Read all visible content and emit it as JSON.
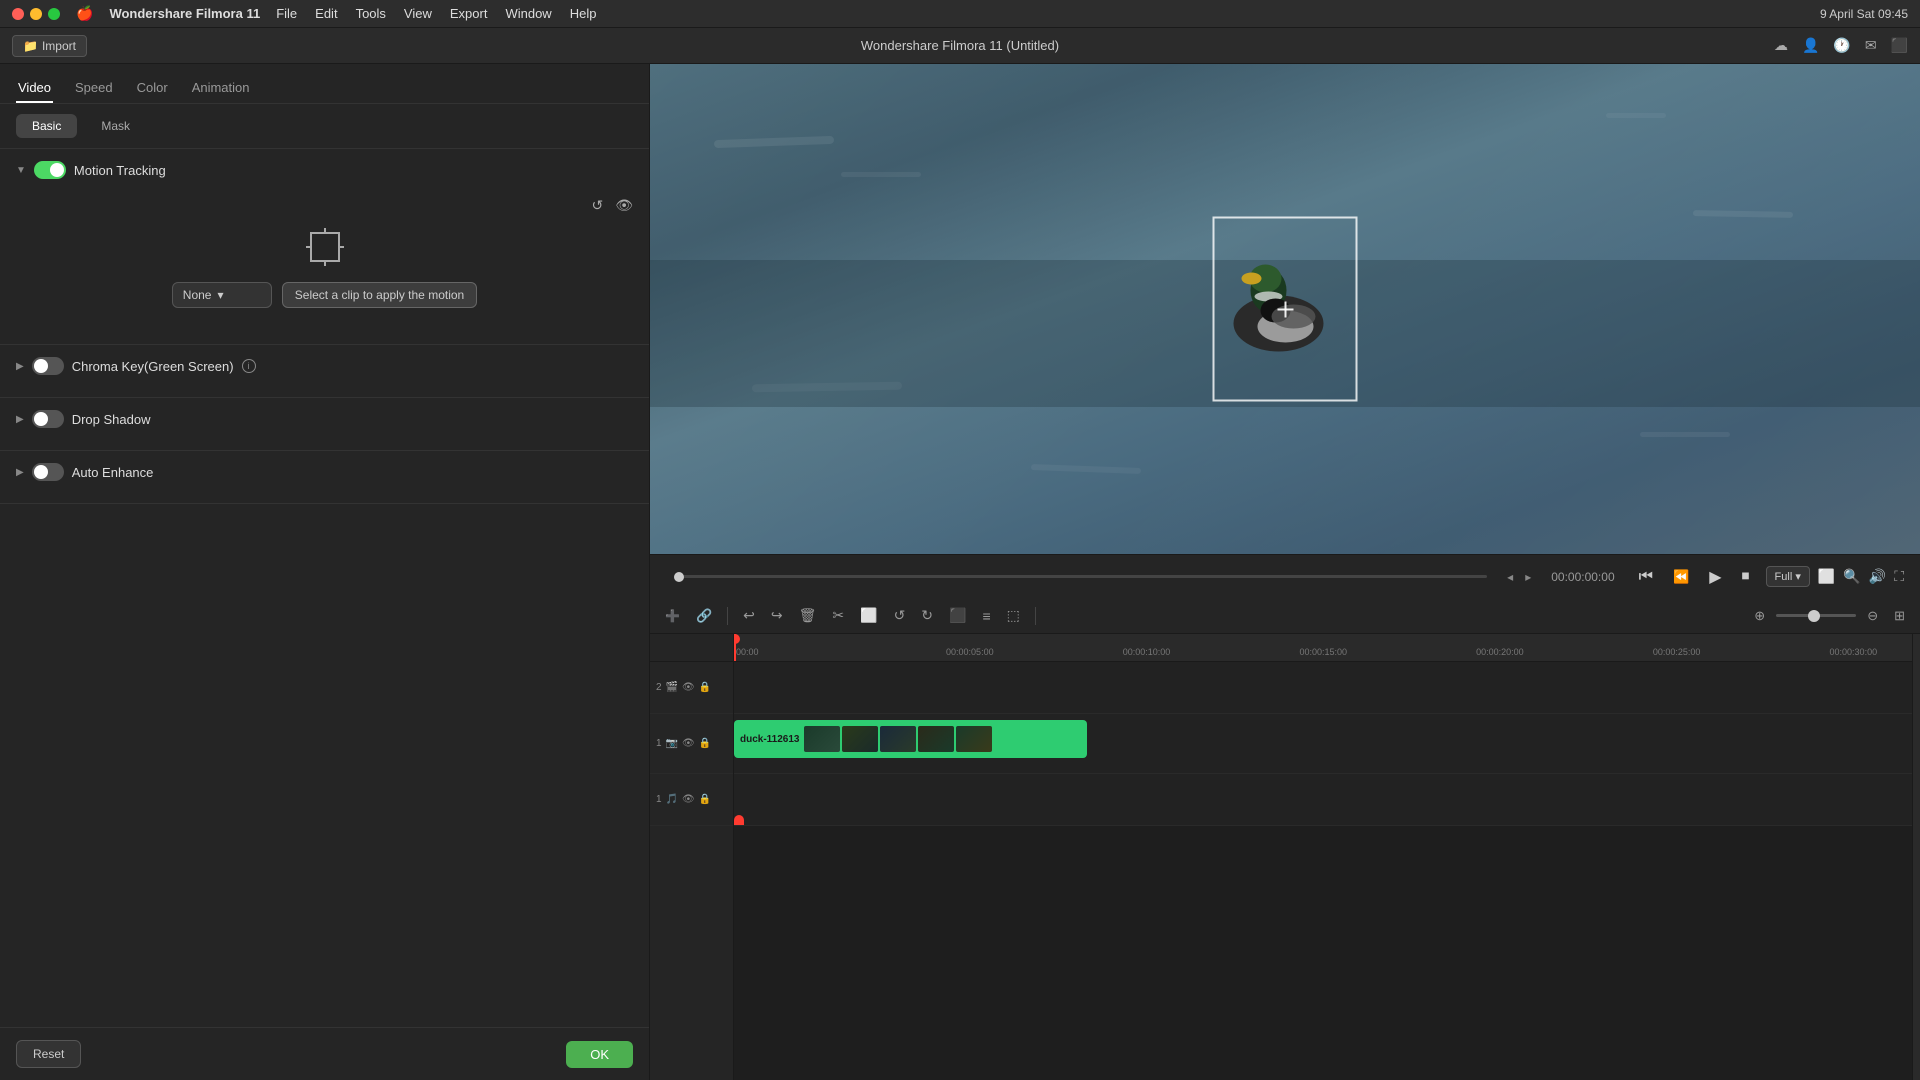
{
  "macos": {
    "apple": "🍎",
    "app_name": "Wondershare Filmora 11",
    "menus": [
      "File",
      "Edit",
      "Tools",
      "View",
      "Export",
      "Window",
      "Help"
    ],
    "time": "9 April Sat  09:45",
    "title": "Wondershare Filmora 11 (Untitled)"
  },
  "left_panel": {
    "tabs": [
      "Video",
      "Speed",
      "Color",
      "Animation"
    ],
    "active_tab": "Video",
    "sub_tabs": [
      "Basic",
      "Mask"
    ],
    "active_sub_tab": "Basic",
    "sections": {
      "motion_tracking": {
        "title": "Motion Tracking",
        "enabled": true,
        "apply_motion_text": "Select a clip to apply the motion",
        "dropdown_value": "None"
      },
      "chroma_key": {
        "title": "Chroma Key(Green Screen)",
        "enabled": false
      },
      "drop_shadow": {
        "title": "Drop Shadow",
        "enabled": false
      },
      "auto_enhance": {
        "title": "Auto Enhance",
        "enabled": false
      }
    },
    "buttons": {
      "reset": "Reset",
      "ok": "OK"
    }
  },
  "preview": {
    "time": "00:00:00:00",
    "quality": "Full",
    "controls": {
      "rewind": "⏮",
      "step_back": "⏪",
      "play": "▶",
      "stop": "⏹"
    }
  },
  "timeline": {
    "tools": [
      "↩",
      "↪",
      "🗑",
      "✂",
      "⬜",
      "↺",
      "↻",
      "⬛",
      "≡",
      "⬚"
    ],
    "tracks": [
      {
        "id": "2",
        "type": "video",
        "icons": [
          "eye",
          "lock"
        ]
      },
      {
        "id": "1",
        "type": "video",
        "icons": [
          "video",
          "eye",
          "lock"
        ],
        "clip": "duck-112613"
      },
      {
        "id": "1",
        "type": "audio",
        "icons": [
          "audio",
          "eye",
          "lock"
        ]
      }
    ],
    "time_markers": [
      "00:00",
      "00:00:05:00",
      "00:00:10:00",
      "00:00:15:00",
      "00:00:20:00",
      "00:00:25:00",
      "00:00:30:00"
    ],
    "playhead_position": "0%",
    "zoom_level": "40%"
  },
  "import_button": "Import"
}
